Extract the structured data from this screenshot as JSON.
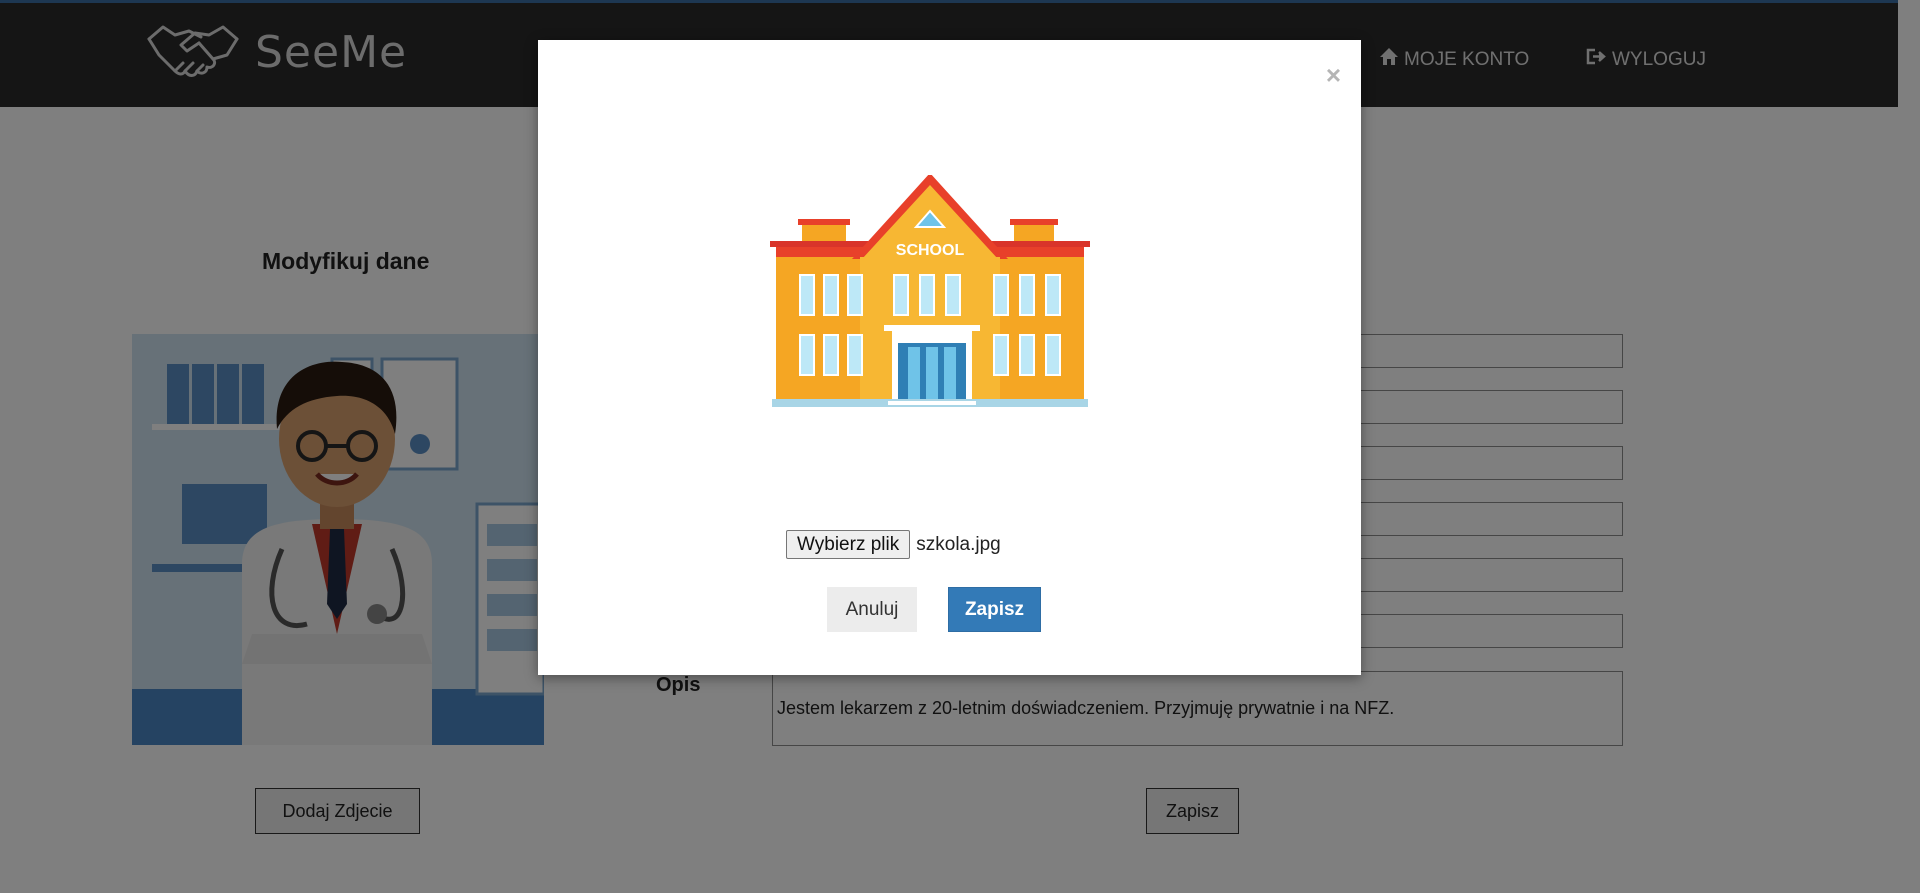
{
  "header": {
    "brand": "SeeMe",
    "nav": {
      "account": "MOJE KONTO",
      "logout": "WYLOGUJ"
    }
  },
  "page": {
    "title": "Modyfikuj dane",
    "opis_label": "Opis",
    "opis_value": "Jestem lekarzem z 20-letnim doświadczeniem. Przyjmuję prywatnie i na NFZ.",
    "add_photo_button": "Dodaj Zdjecie",
    "save_button": "Zapisz"
  },
  "modal": {
    "close_symbol": "×",
    "school_sign": "SCHOOL",
    "file_button": "Wybierz plik",
    "file_name": "szkola.jpg",
    "cancel_button": "Anuluj",
    "submit_button": "Zapisz"
  },
  "colors": {
    "header_bg": "#2b2b2b",
    "primary": "#337ab7",
    "overlay": "rgba(0,0,0,0.5)"
  }
}
